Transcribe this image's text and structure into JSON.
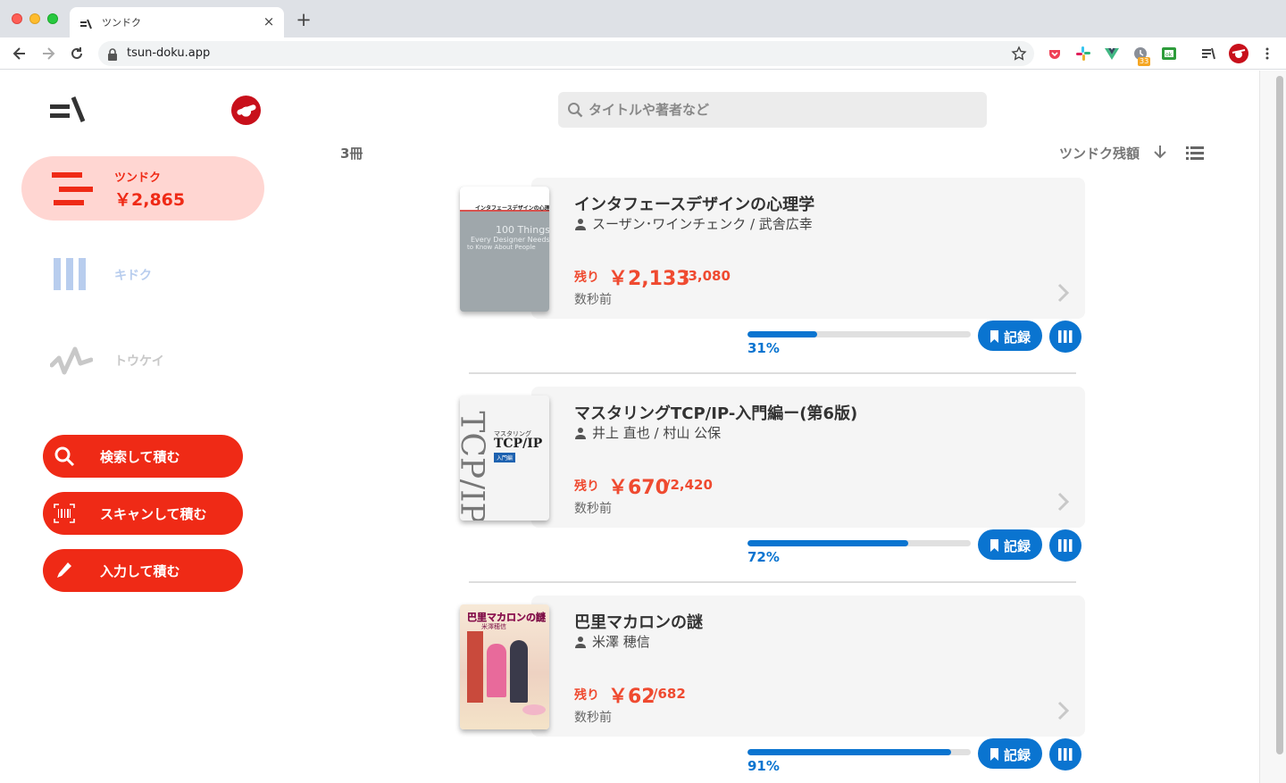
{
  "browser": {
    "tab_title": "ツンドク",
    "url": "tsun-doku.app",
    "extension_badge": "33"
  },
  "sidebar": {
    "nav": {
      "tsundoku_label": "ツンドク",
      "tsundoku_amount": "￥2,865",
      "kidoku_label": "キドク",
      "toukei_label": "トウケイ"
    },
    "actions": {
      "search_label": "検索して積む",
      "scan_label": "スキャンして積む",
      "input_label": "入力して積む"
    }
  },
  "search": {
    "placeholder": "タイトルや著者など"
  },
  "list_header": {
    "count": "3冊",
    "sort_label": "ツンドク残額"
  },
  "books": [
    {
      "title": "インタフェースデザインの心理学",
      "authors": "スーザン･ワインチェンク / 武舎広幸",
      "remain_label": "残り",
      "remain": "￥2,133",
      "total": "/3,080",
      "time": "数秒前",
      "progress_pct": "31%",
      "progress": 0.31,
      "record_label": "記録",
      "cover": {
        "title": "インタフェースデザインの心理学",
        "line1": "100 Things",
        "line2": "Every Designer Needs",
        "line3": "to Know About People"
      }
    },
    {
      "title": "マスタリングTCP/IP-入門編ー(第6版)",
      "authors": "井上 直也 / 村山 公保",
      "remain_label": "残り",
      "remain": "￥670",
      "total": "/2,420",
      "time": "数秒前",
      "progress_pct": "72%",
      "progress": 0.72,
      "record_label": "記録",
      "cover": {
        "big": "TCP/IP",
        "series": "マスタリング",
        "name": "TCP/IP",
        "sub": "入門編"
      }
    },
    {
      "title": "巴里マカロンの謎",
      "authors": "米澤 穂信",
      "remain_label": "残り",
      "remain": "￥62",
      "total": "/682",
      "time": "数秒前",
      "progress_pct": "91%",
      "progress": 0.91,
      "record_label": "記録",
      "cover": {
        "title": "巴里マカロンの謎",
        "author": "米澤穂信"
      }
    }
  ]
}
